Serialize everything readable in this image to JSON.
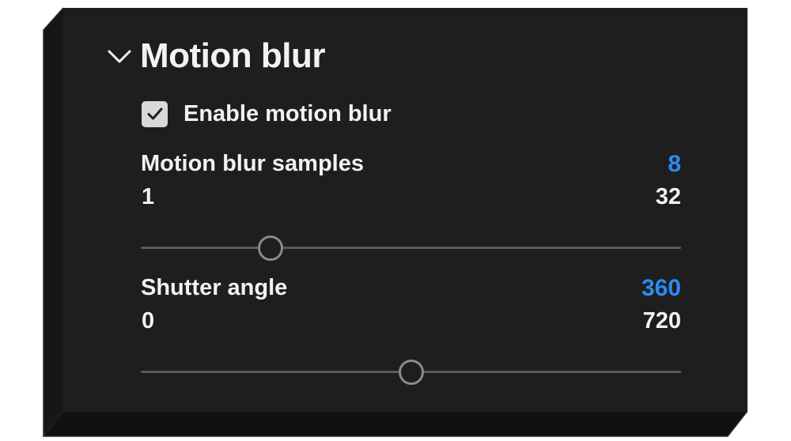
{
  "section": {
    "title": "Motion blur",
    "expanded": true,
    "chevron_icon": "chevron-down-icon"
  },
  "enable": {
    "label": "Enable motion blur",
    "checked": true,
    "check_icon": "checkmark-icon"
  },
  "samples": {
    "label": "Motion blur samples",
    "value": "8",
    "min": "1",
    "max": "32",
    "fraction": 0.24
  },
  "shutter": {
    "label": "Shutter angle",
    "value": "360",
    "min": "0",
    "max": "720",
    "fraction": 0.5
  },
  "colors": {
    "panel": "#1e1e1e",
    "accent": "#2a8cf2",
    "text": "#f2f2f2",
    "track": "#5a5a5a",
    "thumb_border": "#8a8a8a"
  }
}
